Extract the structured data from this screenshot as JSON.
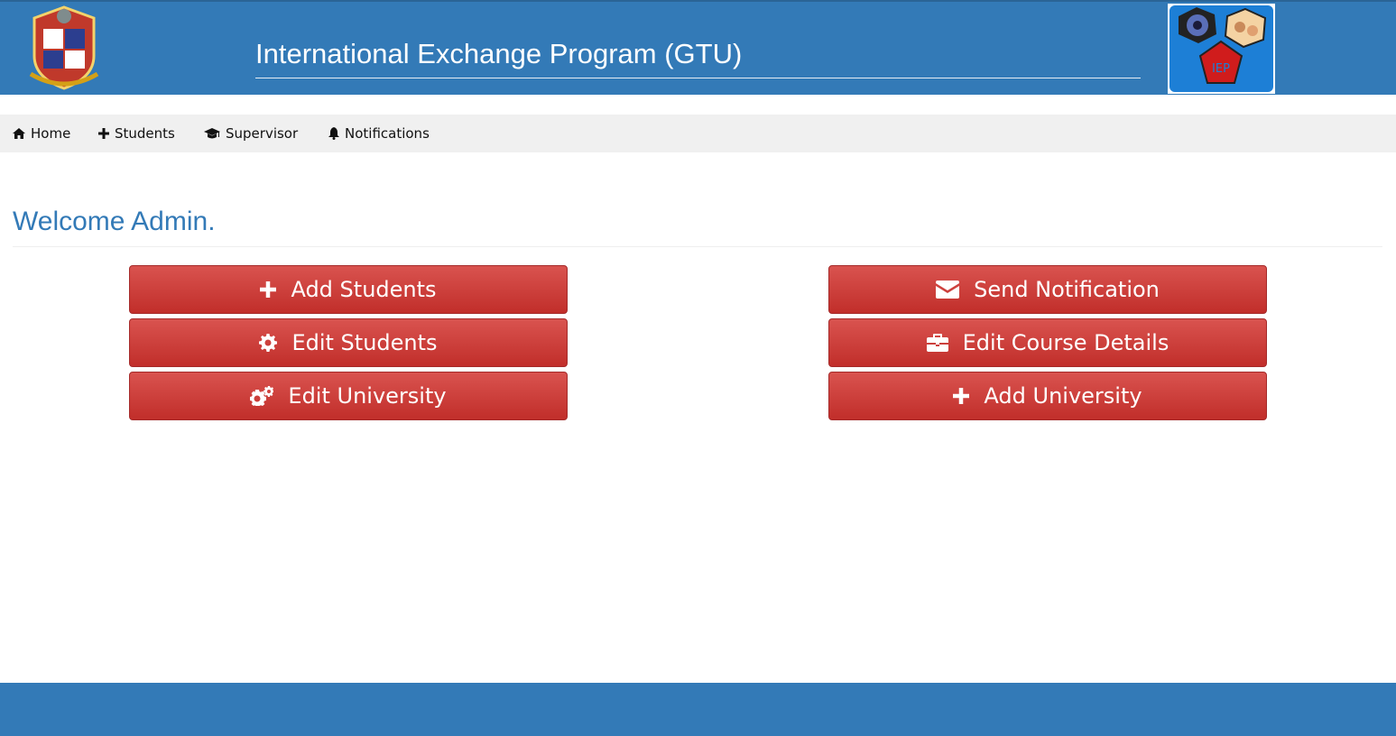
{
  "header": {
    "title": "International Exchange Program (GTU)",
    "logo_right_text": "IEP"
  },
  "nav": {
    "items": [
      {
        "label": "Home",
        "icon": "home-icon"
      },
      {
        "label": "Students",
        "icon": "plus-icon"
      },
      {
        "label": "Supervisor",
        "icon": "graduation-cap-icon"
      },
      {
        "label": "Notifications",
        "icon": "bell-icon"
      }
    ]
  },
  "main": {
    "welcome": "Welcome Admin.",
    "left_buttons": [
      {
        "label": "Add Students",
        "icon": "plus-icon"
      },
      {
        "label": "Edit Students",
        "icon": "gear-icon"
      },
      {
        "label": "Edit University",
        "icon": "gears-icon"
      }
    ],
    "right_buttons": [
      {
        "label": "Send Notification",
        "icon": "envelope-icon"
      },
      {
        "label": "Edit Course Details",
        "icon": "briefcase-icon"
      },
      {
        "label": "Add University",
        "icon": "plus-icon"
      }
    ]
  },
  "colors": {
    "primary": "#337ab7",
    "button": "#d9534f",
    "nav_bg": "#f0f0f0"
  }
}
